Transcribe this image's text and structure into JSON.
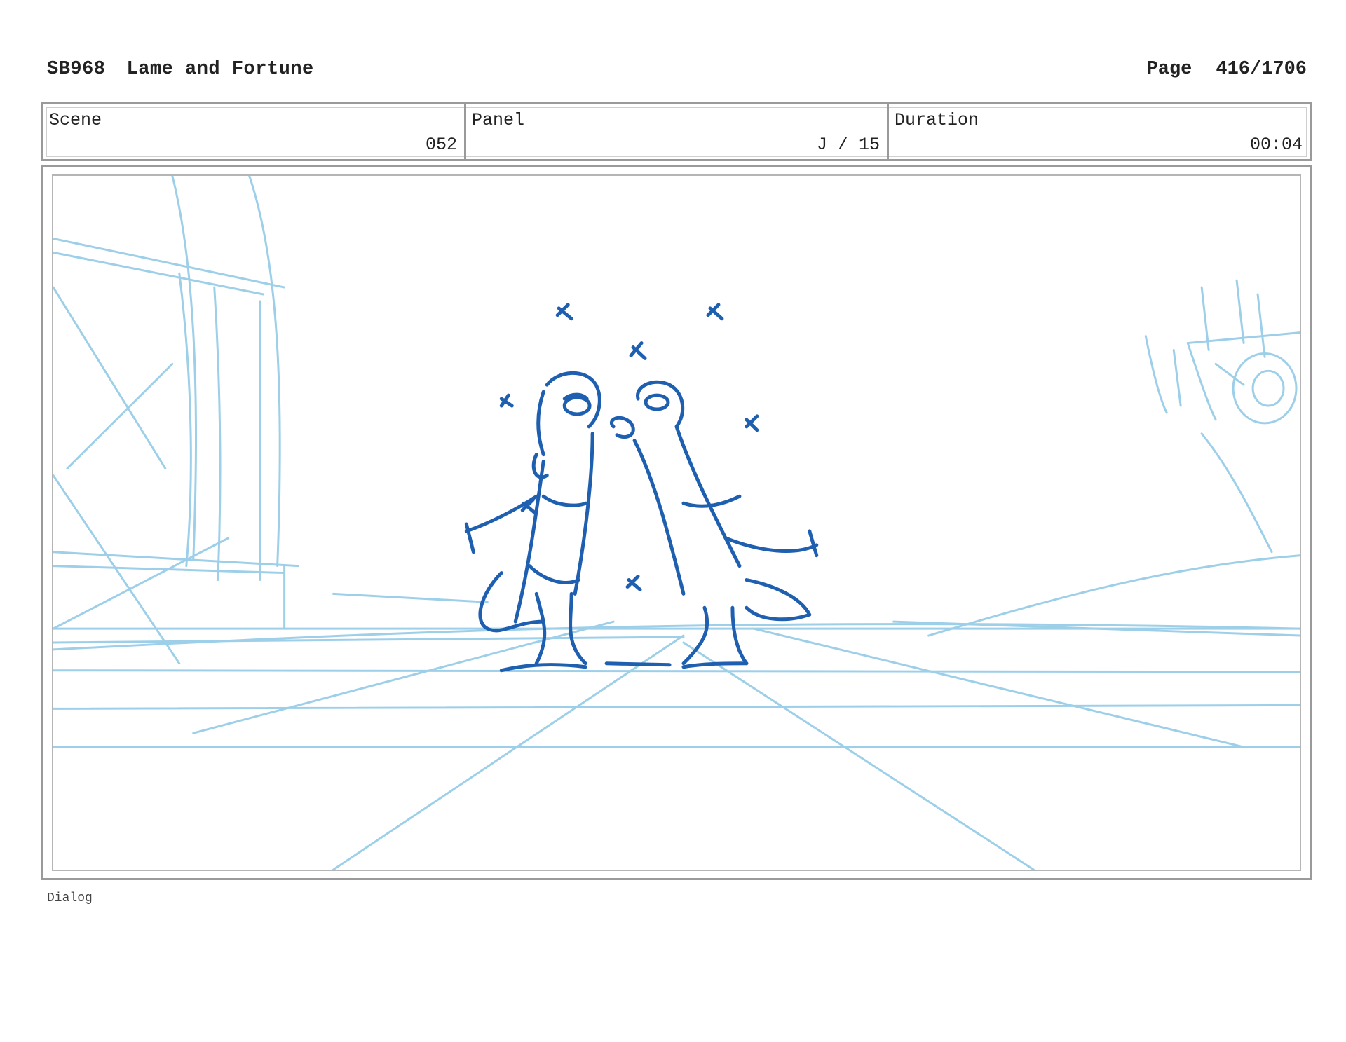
{
  "header": {
    "code": "SB968",
    "title": "Lame and Fortune",
    "page_label": "Page",
    "page_value": "416/1706"
  },
  "info": {
    "scene_label": "Scene",
    "scene_value": "052",
    "panel_label": "Panel",
    "panel_value": "J / 15",
    "duration_label": "Duration",
    "duration_value": "00:04"
  },
  "panel_image": {
    "description_icon": "storyboard-sketch",
    "line_color": "#1f5fb0",
    "layout_color": "#8cc7e6"
  },
  "dialog": {
    "label": "Dialog"
  }
}
